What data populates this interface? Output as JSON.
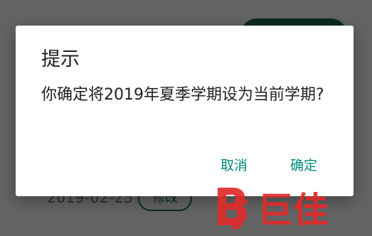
{
  "background": {
    "date_text": "2019-02-25",
    "edit_button_label": "修改"
  },
  "dialog": {
    "title": "提示",
    "message": "你确定将2019年夏季学期设为当前学期?",
    "cancel_label": "取消",
    "confirm_label": "确定"
  },
  "watermark": {
    "text": "巨佳"
  },
  "colors": {
    "accent": "#00897b",
    "primary_dark": "#1c6b52",
    "watermark_red": "#e02b2b"
  }
}
